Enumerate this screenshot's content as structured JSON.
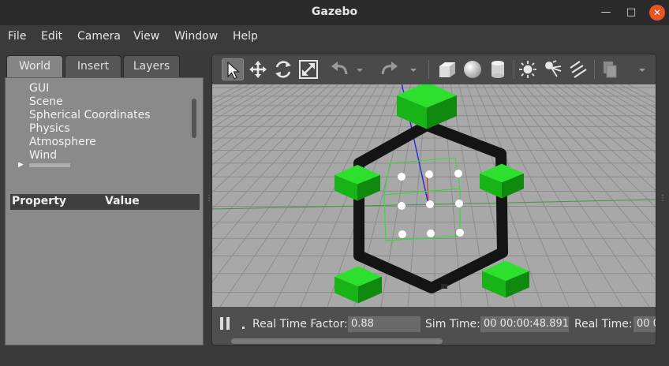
{
  "window": {
    "title": "Gazebo"
  },
  "menu": [
    "File",
    "Edit",
    "Camera",
    "View",
    "Window",
    "Help"
  ],
  "left_panel": {
    "tabs": [
      "World",
      "Insert",
      "Layers"
    ],
    "active_tab": "World",
    "tree": [
      "GUI",
      "Scene",
      "Spherical Coordinates",
      "Physics",
      "Atmosphere",
      "Wind"
    ],
    "property_header": {
      "property": "Property",
      "value": "Value"
    }
  },
  "toolbar": {
    "tools": [
      "select-mode",
      "translate-mode",
      "rotate-mode",
      "scale-mode",
      "undo",
      "redo",
      "box",
      "sphere",
      "cylinder",
      "point-light",
      "spot-light",
      "directional-light",
      "copy"
    ],
    "active_tool": "select-mode"
  },
  "status": {
    "real_time_factor_label": "Real Time Factor:",
    "real_time_factor": "0.88",
    "sim_time_label": "Sim Time:",
    "sim_time": "00 00:00:48.891",
    "real_time_label": "Real Time:",
    "real_time": "00 0"
  },
  "colors": {
    "ground": "#a8a8a8",
    "grid": "#8c8c8c",
    "block": "#1ec21e",
    "arm": "#141414"
  }
}
